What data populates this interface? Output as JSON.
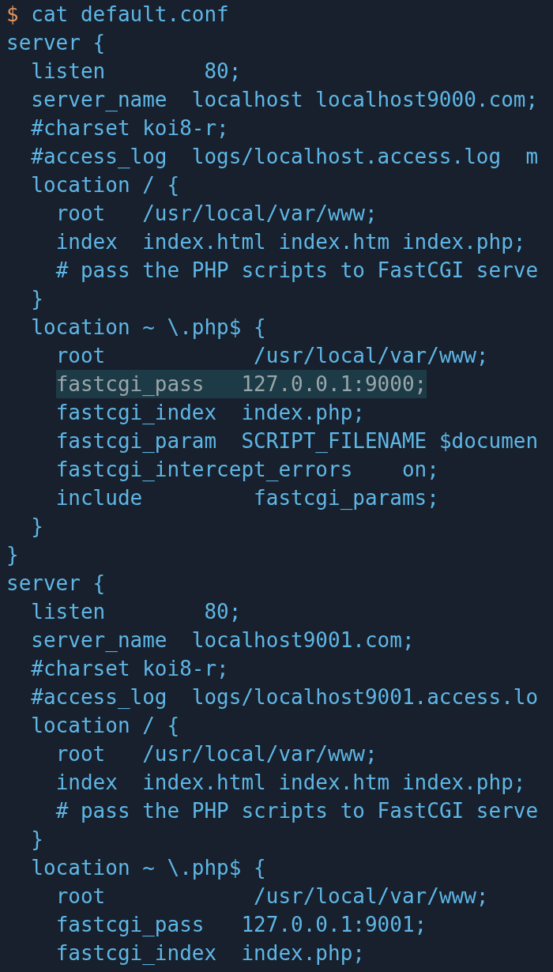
{
  "terminal": {
    "prompt": "$",
    "command": "cat default.conf",
    "lines": [
      {
        "text": "server {",
        "highlighted": false
      },
      {
        "text": "  listen        80;",
        "highlighted": false
      },
      {
        "text": "  server_name  localhost localhost9000.com;",
        "highlighted": false
      },
      {
        "text": "  #charset koi8-r;",
        "highlighted": false
      },
      {
        "text": "  #access_log  logs/localhost.access.log  m",
        "highlighted": false
      },
      {
        "text": "  location / {",
        "highlighted": false
      },
      {
        "text": "    root   /usr/local/var/www;",
        "highlighted": false
      },
      {
        "text": "    index  index.html index.htm index.php;",
        "highlighted": false
      },
      {
        "text": "    # pass the PHP scripts to FastCGI serve",
        "highlighted": false
      },
      {
        "text": "  }",
        "highlighted": false
      },
      {
        "text": "  location ~ \\.php$ {",
        "highlighted": false
      },
      {
        "text": "    root            /usr/local/var/www;",
        "highlighted": false
      },
      {
        "text": "    fastcgi_pass   127.0.0.1:9000;",
        "highlighted": true
      },
      {
        "text": "    fastcgi_index  index.php;",
        "highlighted": false
      },
      {
        "text": "    fastcgi_param  SCRIPT_FILENAME $documen",
        "highlighted": false
      },
      {
        "text": "    fastcgi_intercept_errors    on;",
        "highlighted": false
      },
      {
        "text": "    include         fastcgi_params;",
        "highlighted": false
      },
      {
        "text": "  }",
        "highlighted": false
      },
      {
        "text": "}",
        "highlighted": false
      },
      {
        "text": "server {",
        "highlighted": false
      },
      {
        "text": "  listen        80;",
        "highlighted": false
      },
      {
        "text": "  server_name  localhost9001.com;",
        "highlighted": false
      },
      {
        "text": "  #charset koi8-r;",
        "highlighted": false
      },
      {
        "text": "  #access_log  logs/localhost9001.access.lo",
        "highlighted": false
      },
      {
        "text": "  location / {",
        "highlighted": false
      },
      {
        "text": "    root   /usr/local/var/www;",
        "highlighted": false
      },
      {
        "text": "    index  index.html index.htm index.php;",
        "highlighted": false
      },
      {
        "text": "    # pass the PHP scripts to FastCGI serve",
        "highlighted": false
      },
      {
        "text": "  }",
        "highlighted": false
      },
      {
        "text": "  location ~ \\.php$ {",
        "highlighted": false
      },
      {
        "text": "    root            /usr/local/var/www;",
        "highlighted": false
      },
      {
        "text": "    fastcgi_pass   127.0.0.1:9001;",
        "highlighted": false
      },
      {
        "text": "    fastcgi_index  index.php;",
        "highlighted": false
      }
    ]
  }
}
